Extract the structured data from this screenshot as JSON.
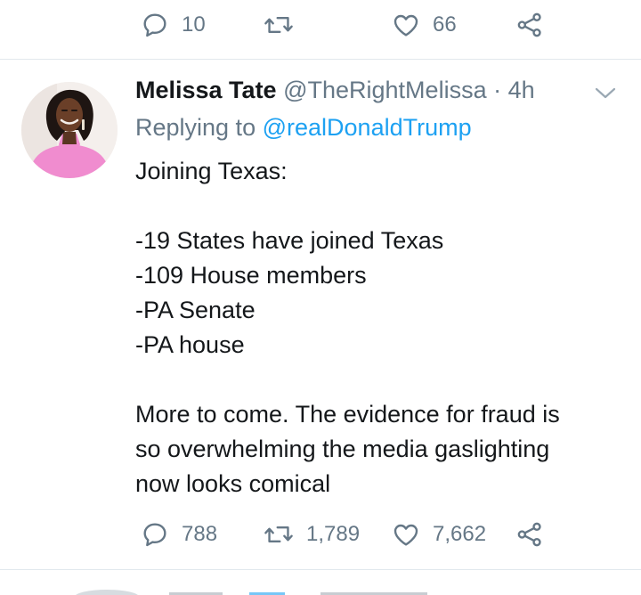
{
  "prev_tweet": {
    "reply_count": "10",
    "retweet_count": "",
    "like_count": "66"
  },
  "tweet": {
    "display_name": "Melissa Tate",
    "handle": "@TheRightMelissa",
    "separator": "·",
    "time": "4h",
    "replying_prefix": "Replying to",
    "replying_to": "@realDonaldTrump",
    "body_lines": [
      "Joining Texas:",
      "",
      "-19 States have joined Texas",
      "-109 House members",
      "-PA Senate",
      "-PA house",
      "",
      "More to come. The evidence for fraud is",
      "so overwhelming the media gaslighting",
      "now looks comical"
    ],
    "reply_count": "788",
    "retweet_count": "1,789",
    "like_count": "7,662"
  },
  "colors": {
    "text": "#14171a",
    "secondary": "#657786",
    "link": "#1da1f2",
    "divider": "#e1e8ed",
    "avatar_outfit": "#f08ccf"
  },
  "icons": [
    "reply-icon",
    "retweet-icon",
    "like-icon",
    "share-icon",
    "chevron-down-icon"
  ]
}
